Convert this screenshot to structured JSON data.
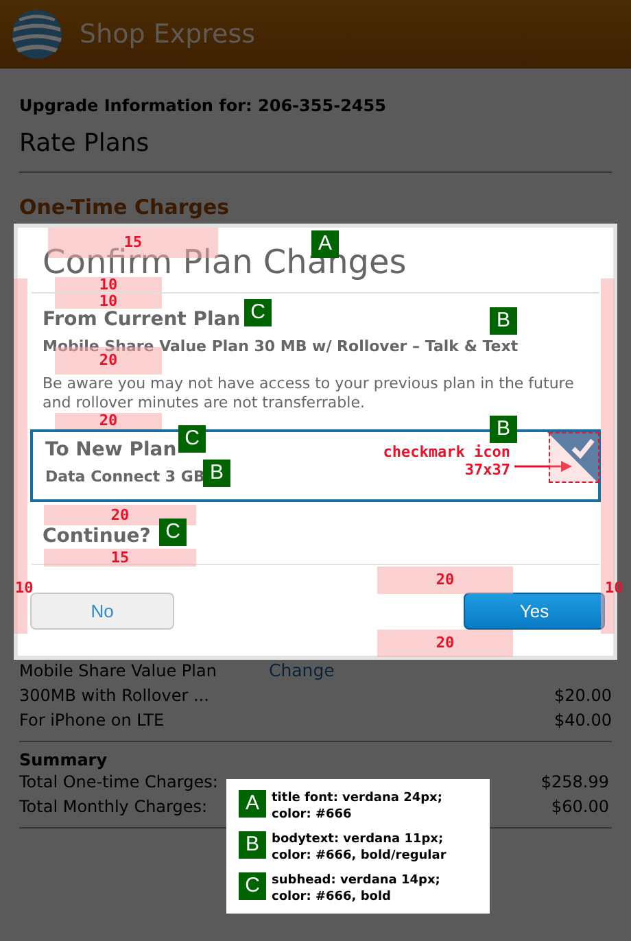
{
  "header": {
    "title": "Shop Express"
  },
  "page": {
    "upgrade_info": "Upgrade Information for: 206-355-2455",
    "heading": "Rate Plans",
    "section": "One-Time Charges",
    "plan_rows": [
      {
        "label": "Mobile Share Value Plan",
        "link": "Change"
      },
      {
        "label": "300MB with Rollover ...",
        "amount": "$20.00"
      },
      {
        "label": "For iPhone on LTE",
        "amount": "$40.00"
      }
    ],
    "summary": {
      "title": "Summary",
      "rows": [
        {
          "label": "Total One-time Charges:",
          "amount": "$258.99"
        },
        {
          "label": "Total Monthly Charges:",
          "amount": "$60.00"
        }
      ]
    }
  },
  "modal": {
    "title": "Confirm Plan Changes",
    "current_plan": {
      "heading": "From Current Plan",
      "name": "Mobile Share Value Plan 30 MB w/ Rollover – Talk & Text"
    },
    "notice": "Be aware you may not have access to your previous plan in the future and rollover minutes are not transferrable.",
    "new_plan": {
      "heading": "To New Plan",
      "name": "Data Connect 3 GB",
      "selected": true
    },
    "question": "Continue?",
    "buttons": [
      {
        "label": "No",
        "kind": "secondary"
      },
      {
        "label": "Yes",
        "kind": "primary"
      }
    ]
  },
  "annotations": {
    "spacings": [
      {
        "label": "15"
      },
      {
        "label": "10"
      },
      {
        "label": "10"
      },
      {
        "label": "20"
      },
      {
        "label": "20"
      },
      {
        "label": "20"
      },
      {
        "label": "15"
      },
      {
        "label": "20"
      },
      {
        "label": "20"
      },
      {
        "label": "10"
      },
      {
        "label": "10"
      }
    ],
    "badges": [
      {
        "label": "A"
      },
      {
        "label": "C"
      },
      {
        "label": "B"
      },
      {
        "label": "B"
      },
      {
        "label": "C"
      },
      {
        "label": "B"
      },
      {
        "label": "C"
      }
    ],
    "callout": [
      "checkmark icon",
      "37x37"
    ],
    "legend": [
      {
        "key": "A",
        "text": "title font: verdana 24px; color: #666"
      },
      {
        "key": "B",
        "text": "bodytext: verdana 11px; color: #666, bold/regular"
      },
      {
        "key": "C",
        "text": "subhead: verdana 14px; color: #666, bold"
      }
    ]
  }
}
